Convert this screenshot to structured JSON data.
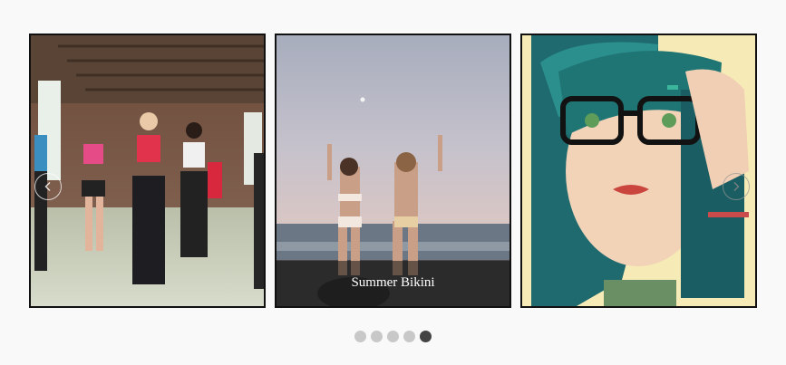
{
  "carousel": {
    "slides": [
      {
        "caption": ""
      },
      {
        "caption": "Summer Bikini"
      },
      {
        "caption": ""
      }
    ],
    "dots_count": 5,
    "active_dot": 5,
    "prev_icon": "chevron-left-icon",
    "next_icon": "chevron-right-icon"
  }
}
